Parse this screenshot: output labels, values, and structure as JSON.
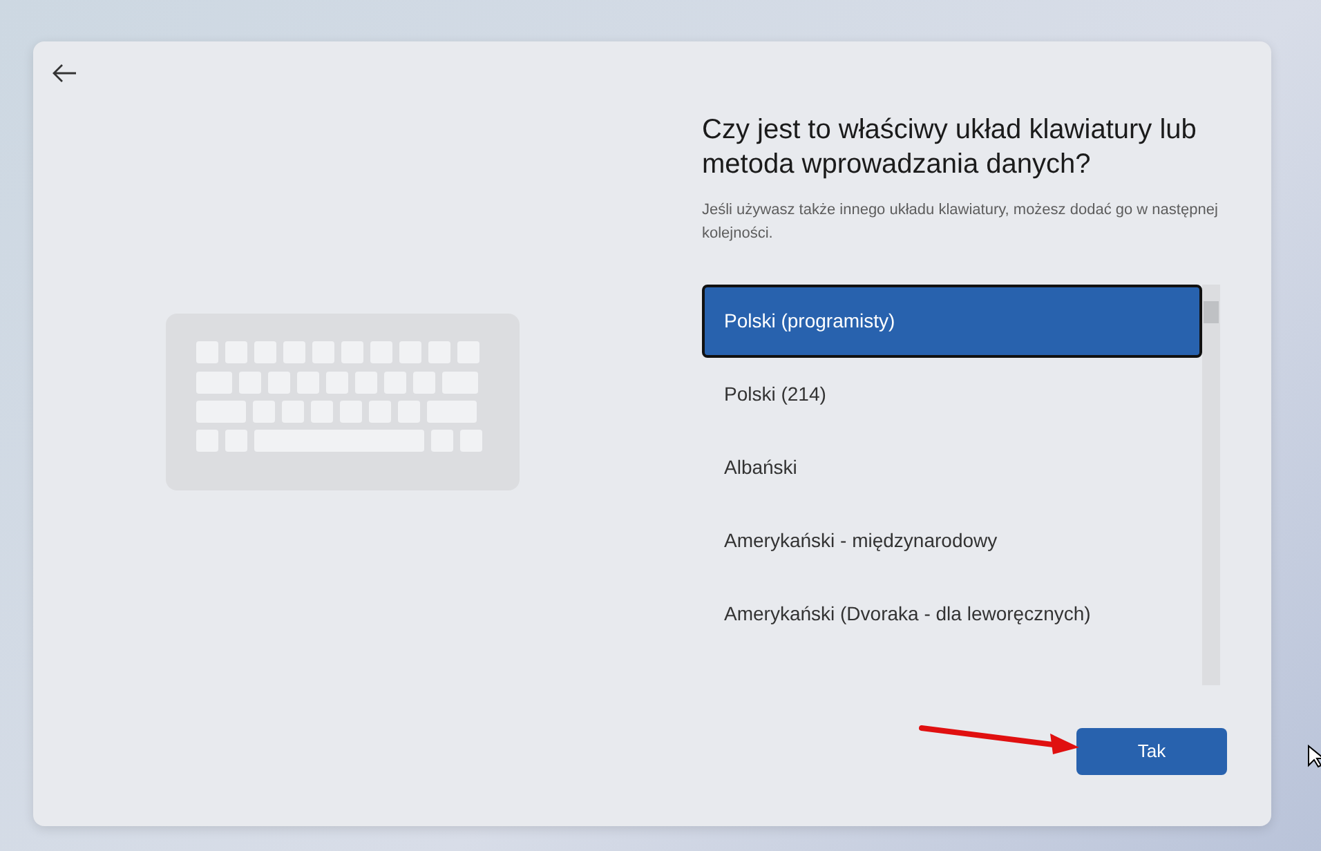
{
  "title": "Czy jest to właściwy układ klawiatury lub metoda wprowadzania danych?",
  "subtitle": "Jeśli używasz także innego układu klawiatury, możesz dodać go w następnej kolejności.",
  "layouts": [
    {
      "label": "Polski (programisty)",
      "selected": true
    },
    {
      "label": "Polski (214)",
      "selected": false
    },
    {
      "label": "Albański",
      "selected": false
    },
    {
      "label": "Amerykański - międzynarodowy",
      "selected": false
    },
    {
      "label": "Amerykański (Dvoraka - dla leworęcznych)",
      "selected": false
    }
  ],
  "confirm_button": "Tak"
}
